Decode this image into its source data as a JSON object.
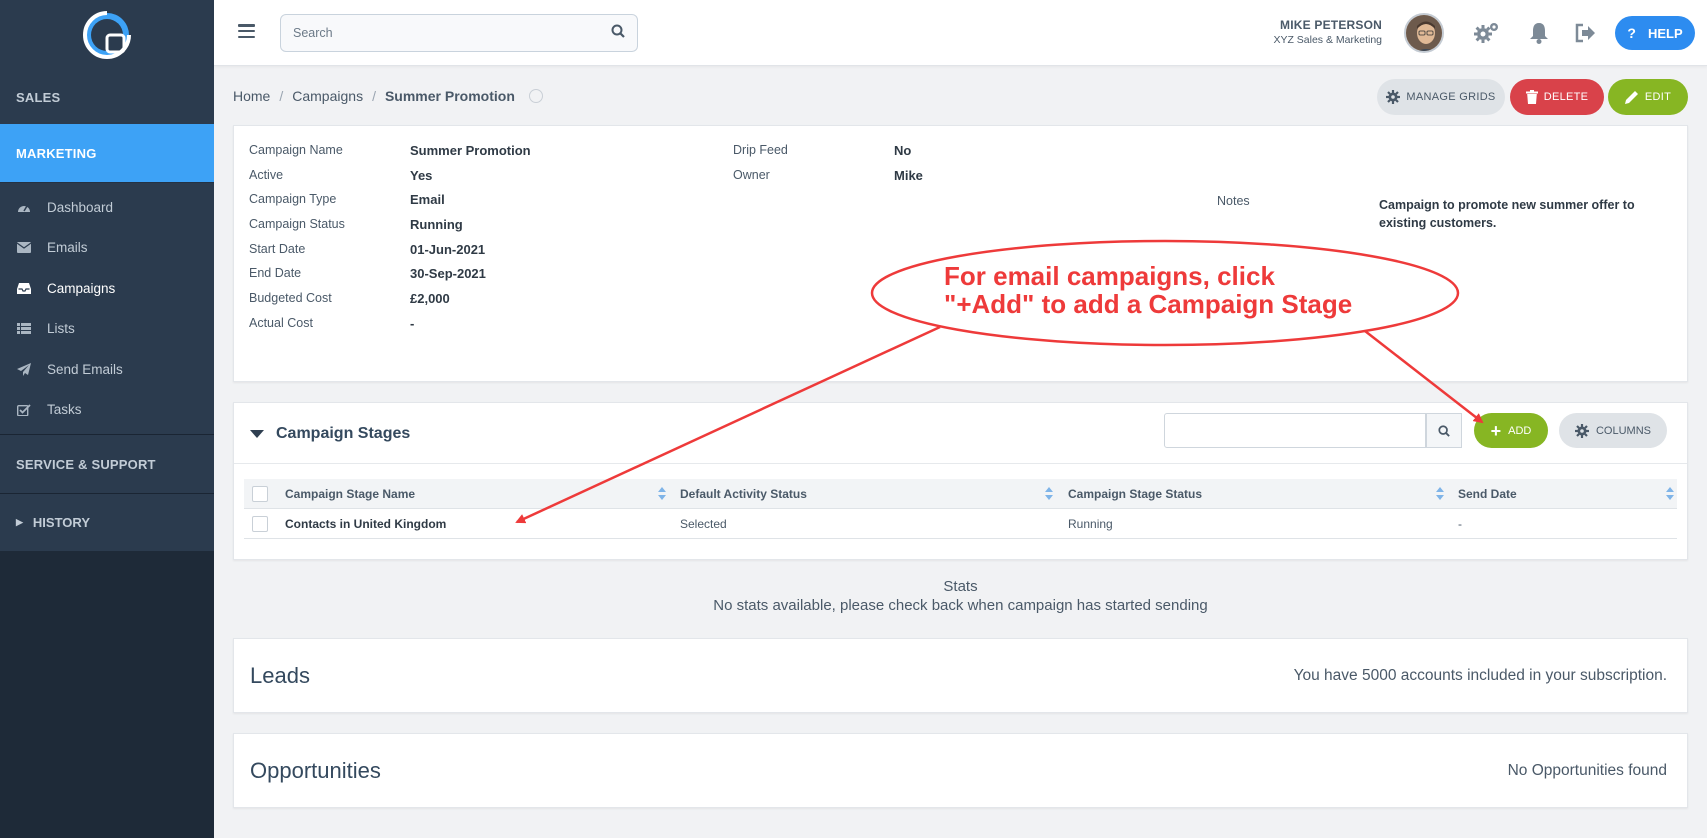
{
  "sidebar": {
    "sections": {
      "sales": "SALES",
      "marketing": "MARKETING",
      "service": "SERVICE & SUPPORT",
      "history": "HISTORY"
    },
    "items": [
      {
        "label": "Dashboard",
        "icon": "dashboard-icon"
      },
      {
        "label": "Emails",
        "icon": "envelope-icon"
      },
      {
        "label": "Campaigns",
        "icon": "inbox-icon"
      },
      {
        "label": "Lists",
        "icon": "list-icon"
      },
      {
        "label": "Send Emails",
        "icon": "paper-plane-icon"
      },
      {
        "label": "Tasks",
        "icon": "checkbox-icon"
      }
    ]
  },
  "topbar": {
    "search_placeholder": "Search",
    "user_name": "MIKE PETERSON",
    "user_org": "XYZ Sales & Marketing",
    "help_label": "HELP"
  },
  "breadcrumb": {
    "home": "Home",
    "campaigns": "Campaigns",
    "current": "Summer Promotion"
  },
  "actions": {
    "manage_grids": "MANAGE GRIDS",
    "delete": "DELETE",
    "edit": "EDIT"
  },
  "details": {
    "campaign_name_label": "Campaign Name",
    "campaign_name": "Summer Promotion",
    "active_label": "Active",
    "active": "Yes",
    "type_label": "Campaign Type",
    "type": "Email",
    "status_label": "Campaign Status",
    "status": "Running",
    "start_label": "Start Date",
    "start": "01-Jun-2021",
    "end_label": "End Date",
    "end": "30-Sep-2021",
    "budget_label": "Budgeted Cost",
    "budget": "£2,000",
    "actual_label": "Actual Cost",
    "actual": "-",
    "drip_label": "Drip Feed",
    "drip": "No",
    "owner_label": "Owner",
    "owner": "Mike",
    "notes_label": "Notes",
    "notes": "Campaign to promote new summer offer to existing customers."
  },
  "stages": {
    "title": "Campaign Stages",
    "add_label": "ADD",
    "columns_label": "COLUMNS",
    "headers": [
      "Campaign Stage Name",
      "Default Activity Status",
      "Campaign Stage Status",
      "Send Date"
    ],
    "rows": [
      [
        "Contacts in United Kingdom",
        "Selected",
        "Running",
        "-"
      ]
    ]
  },
  "stats": {
    "title": "Stats",
    "message": "No stats available, please check back when campaign has started sending"
  },
  "leads": {
    "title": "Leads",
    "message": "You have 5000 accounts included in your subscription."
  },
  "opportunities": {
    "title": "Opportunities",
    "message": "No Opportunities found"
  },
  "annotation": {
    "line1": "For email campaigns, click",
    "line2": "\"+Add\" to add a Campaign Stage",
    "color": "#ee3a3a"
  }
}
